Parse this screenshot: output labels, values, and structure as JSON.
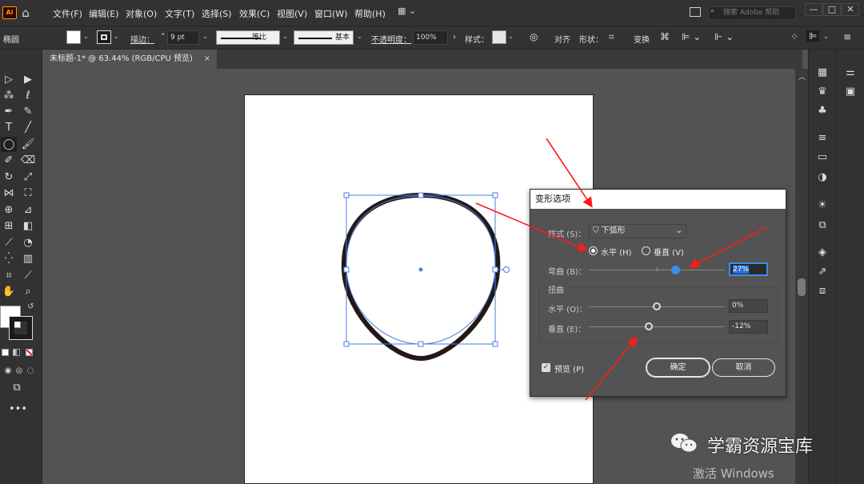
{
  "menubar": {
    "logo": "Ai",
    "items": [
      "文件(F)",
      "编辑(E)",
      "对象(O)",
      "文字(T)",
      "选择(S)",
      "效果(C)",
      "视图(V)",
      "窗口(W)",
      "帮助(H)"
    ],
    "search_placeholder": "搜索 Adobe 帮助"
  },
  "control_bar": {
    "object_type": "椭圆",
    "stroke_label": "描边：",
    "stroke_weight": "9 pt",
    "profile_label": "等比",
    "brush_label": "基本",
    "opacity_label": "不透明度：",
    "opacity_value": "100%",
    "style_label": "样式：",
    "align_label": "对齐",
    "shape_label": "形状：",
    "transform_label": "变换"
  },
  "document_tab": {
    "title": "未标题-1* @ 63.44% (RGB/CPU 预览)",
    "close": "×"
  },
  "dialog": {
    "title": "变形选项",
    "style_label": "样式 (S)：",
    "style_value": "下弧形",
    "horizontal_label": "水平 (H)",
    "vertical_label": "垂直 (V)",
    "orientation_selected": "水平 (H)",
    "bend_label": "弯曲 (B)：",
    "bend_value": "27%",
    "bend_level": 0.635,
    "distort_label": "扭曲",
    "distort_h_label": "水平 (O)：",
    "distort_h_value": "0%",
    "distort_h_level": 0.5,
    "distort_v_label": "垂直 (E)：",
    "distort_v_value": "-12%",
    "distort_v_level": 0.44,
    "preview_label": "预览 (P)",
    "preview_checked": true,
    "ok_label": "确定",
    "cancel_label": "取消"
  },
  "watermark": {
    "text": "学霸资源宝库",
    "windows_activation": "激活 Windows"
  },
  "colors": {
    "bend_slider": "#3a8eea",
    "annotation_arrow": "#ff1a1a",
    "shape_stroke": "#231815",
    "selection": "#4a7ee0"
  }
}
